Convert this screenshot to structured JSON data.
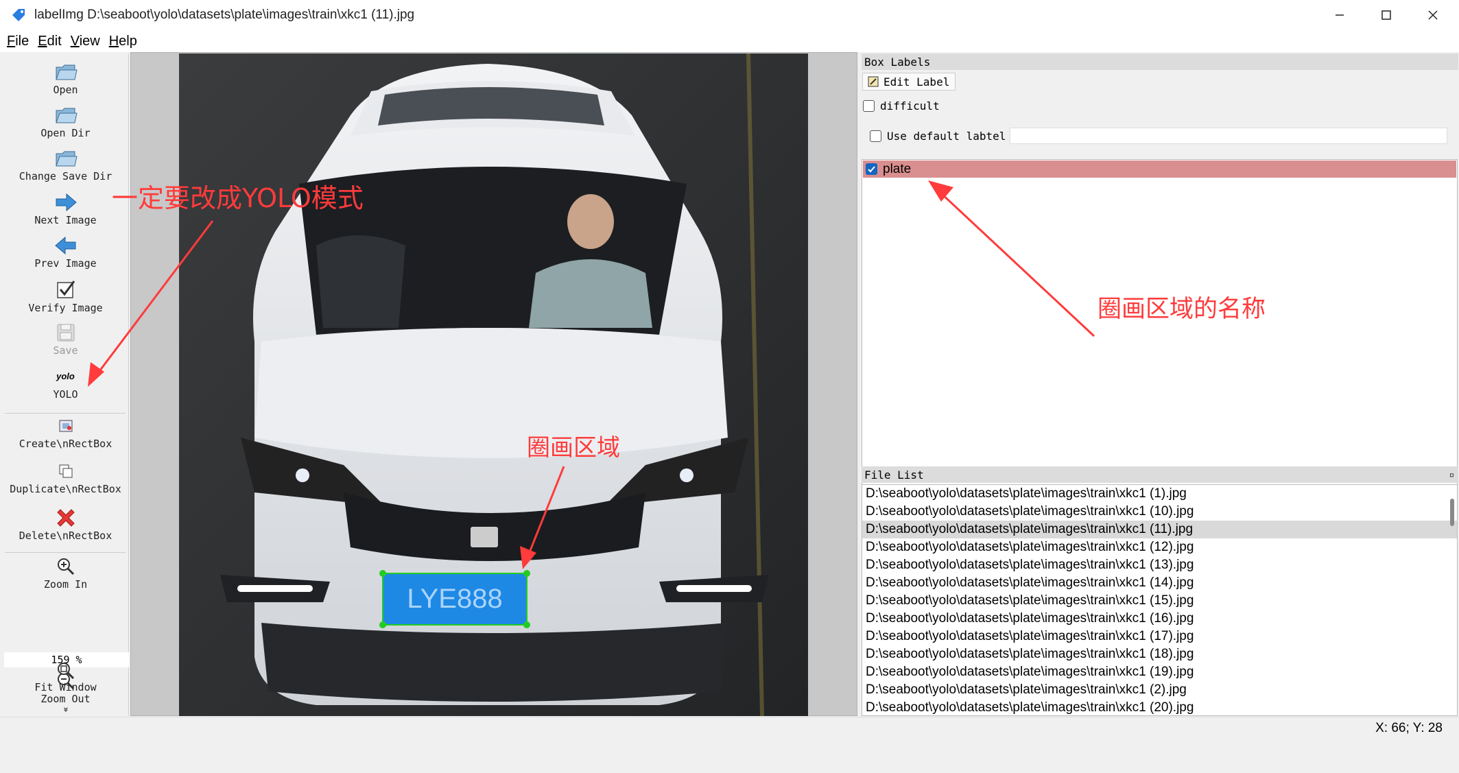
{
  "window": {
    "title": "labelImg D:\\seaboot\\yolo\\datasets\\plate\\images\\train\\xkc1 (11).jpg",
    "controls": {
      "minimize": "minimize-icon",
      "maximize": "maximize-icon",
      "close": "close-icon"
    }
  },
  "menu": [
    {
      "first": "F",
      "rest": "ile"
    },
    {
      "first": "E",
      "rest": "dit"
    },
    {
      "first": "V",
      "rest": "iew"
    },
    {
      "first": "H",
      "rest": "elp"
    }
  ],
  "toolbar": {
    "open": "Open",
    "open_dir": "Open Dir",
    "change_save_dir": "Change Save Dir",
    "next_image": "Next Image",
    "prev_image": "Prev Image",
    "verify_image": "Verify Image",
    "save": "Save",
    "format_icon_text": "yolo",
    "format": "YOLO",
    "create_rectbox": "Create\\nRectBox",
    "duplicate_rectbox": "Duplicate\\nRectBox",
    "delete_rectbox": "Delete\\nRectBox",
    "zoom_in": "Zoom In",
    "zoom_value": "159 %",
    "zoom_out": "Zoom Out",
    "fit_window": "Fit Window",
    "more": "»"
  },
  "box_labels": {
    "header": "Box Labels",
    "edit_label": "Edit Label",
    "difficult": "difficult",
    "use_default_label": "Use default labtel",
    "default_label_value": "",
    "labels": [
      {
        "name": "plate",
        "checked": true,
        "color": "#d98f8f"
      }
    ]
  },
  "file_list": {
    "header": "File List",
    "files": [
      "D:\\seaboot\\yolo\\datasets\\plate\\images\\train\\xkc1 (1).jpg",
      "D:\\seaboot\\yolo\\datasets\\plate\\images\\train\\xkc1 (10).jpg",
      "D:\\seaboot\\yolo\\datasets\\plate\\images\\train\\xkc1 (11).jpg",
      "D:\\seaboot\\yolo\\datasets\\plate\\images\\train\\xkc1 (12).jpg",
      "D:\\seaboot\\yolo\\datasets\\plate\\images\\train\\xkc1 (13).jpg",
      "D:\\seaboot\\yolo\\datasets\\plate\\images\\train\\xkc1 (14).jpg",
      "D:\\seaboot\\yolo\\datasets\\plate\\images\\train\\xkc1 (15).jpg",
      "D:\\seaboot\\yolo\\datasets\\plate\\images\\train\\xkc1 (16).jpg",
      "D:\\seaboot\\yolo\\datasets\\plate\\images\\train\\xkc1 (17).jpg",
      "D:\\seaboot\\yolo\\datasets\\plate\\images\\train\\xkc1 (18).jpg",
      "D:\\seaboot\\yolo\\datasets\\plate\\images\\train\\xkc1 (19).jpg",
      "D:\\seaboot\\yolo\\datasets\\plate\\images\\train\\xkc1 (2).jpg",
      "D:\\seaboot\\yolo\\datasets\\plate\\images\\train\\xkc1 (20).jpg"
    ],
    "selected_index": 2
  },
  "annotations": {
    "yolo_mode": "一定要改成YOLO模式",
    "region": "圈画区域",
    "region_name": "圈画区域的名称",
    "color": "#ff3b3b"
  },
  "plate_text": "LYE888",
  "status": {
    "coords": "X: 66; Y: 28"
  },
  "colors": {
    "selected_label": "#d98f8f",
    "bbox": "#22cc22",
    "plate": "#1e88e5"
  }
}
